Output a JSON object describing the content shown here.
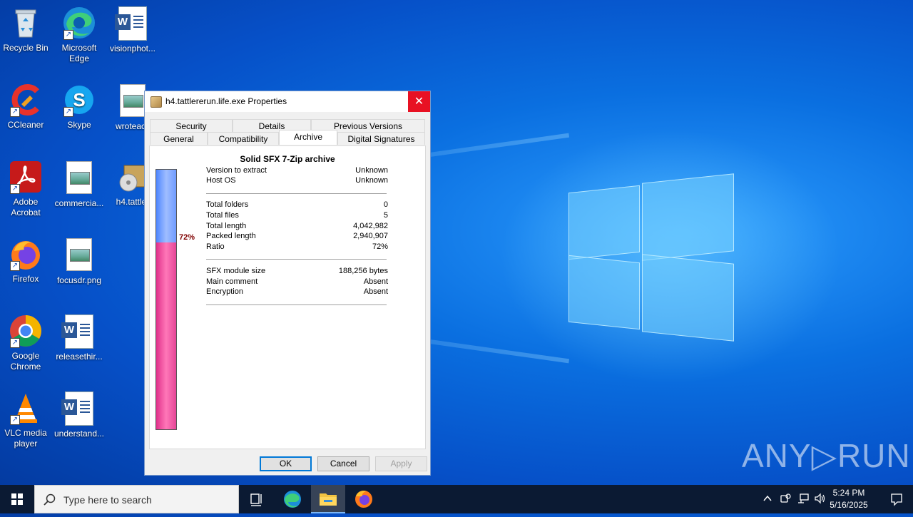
{
  "desktop": {
    "icons": [
      {
        "label": "Recycle Bin"
      },
      {
        "label": "Microsoft Edge"
      },
      {
        "label": "visionphot..."
      },
      {
        "label": "CCleaner"
      },
      {
        "label": "Skype"
      },
      {
        "label": "wroteacc"
      },
      {
        "label": "Adobe Acrobat"
      },
      {
        "label": "commercia..."
      },
      {
        "label": "h4.tattler"
      },
      {
        "label": "Firefox"
      },
      {
        "label": "focusdr.png"
      },
      {
        "label": "Google Chrome"
      },
      {
        "label": "releasethir..."
      },
      {
        "label": "VLC media player"
      },
      {
        "label": "understand..."
      }
    ]
  },
  "dialog": {
    "title": "h4.tattlererun.life.exe Properties",
    "close_symbol": "✕",
    "tabs_row1": [
      "Security",
      "Details",
      "Previous Versions"
    ],
    "tabs_row2": [
      "General",
      "Compatibility",
      "Archive",
      "Digital Signatures"
    ],
    "active_tab": "Archive",
    "archive": {
      "heading": "Solid SFX 7-Zip archive",
      "ratio_label": "72%",
      "ratio_fraction": 0.72,
      "group1": [
        {
          "key": "Version to extract",
          "value": "Unknown"
        },
        {
          "key": "Host OS",
          "value": "Unknown"
        }
      ],
      "group2": [
        {
          "key": "Total folders",
          "value": "0"
        },
        {
          "key": "Total files",
          "value": "5"
        },
        {
          "key": "Total length",
          "value": "4,042,982"
        },
        {
          "key": "Packed length",
          "value": "2,940,907"
        },
        {
          "key": "Ratio",
          "value": "72%"
        }
      ],
      "group3": [
        {
          "key": "SFX module size",
          "value": "188,256 bytes"
        },
        {
          "key": "Main comment",
          "value": "Absent"
        },
        {
          "key": "Encryption",
          "value": "Absent"
        }
      ]
    },
    "buttons": {
      "ok": "OK",
      "cancel": "Cancel",
      "apply": "Apply"
    }
  },
  "watermark": "ANY▷RUN",
  "taskbar": {
    "search_placeholder": "Type here to search",
    "time": "5:24 PM",
    "date": "5/16/2025"
  }
}
